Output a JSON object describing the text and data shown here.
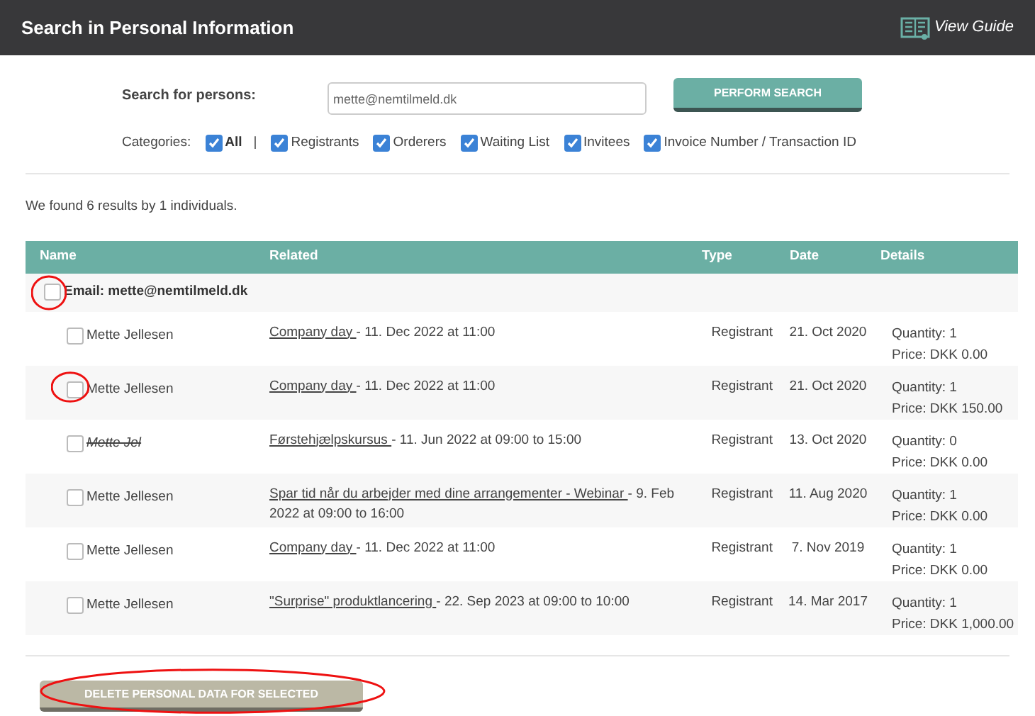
{
  "header": {
    "title": "Search in Personal Information",
    "guide_link": "View Guide"
  },
  "search": {
    "label": "Search for persons:",
    "value": "mette@nemtilmeld.dk",
    "button": "PERFORM SEARCH"
  },
  "categories": {
    "label": "Categories:",
    "separator": "|",
    "items": [
      {
        "label": "All",
        "checked": true,
        "bold": true
      },
      {
        "label": "Registrants",
        "checked": true,
        "bold": false
      },
      {
        "label": "Orderers",
        "checked": true,
        "bold": false
      },
      {
        "label": "Waiting List",
        "checked": true,
        "bold": false
      },
      {
        "label": "Invitees",
        "checked": true,
        "bold": false
      },
      {
        "label": "Invoice Number / Transaction ID",
        "checked": true,
        "bold": false
      }
    ]
  },
  "results_summary": "We found 6 results by 1 individuals.",
  "table": {
    "columns": [
      "Name",
      "Related",
      "Type",
      "Date",
      "Details"
    ],
    "group": {
      "label": "Email: mette@nemtilmeld.dk",
      "checked": false,
      "circled": true
    },
    "rows": [
      {
        "name": "Mette Jellesen",
        "cancelled": false,
        "checked": false,
        "circled": false,
        "event": "Company day ",
        "when": " - 11. Dec 2022 at 11:00",
        "type": "Registrant",
        "date": "21. Oct 2020",
        "quantity": "Quantity: 1",
        "price": "Price: DKK 0.00"
      },
      {
        "name": "Mette Jellesen",
        "cancelled": false,
        "checked": false,
        "circled": true,
        "event": "Company day ",
        "when": " - 11. Dec 2022 at 11:00",
        "type": "Registrant",
        "date": "21. Oct 2020",
        "quantity": "Quantity: 1",
        "price": "Price: DKK 150.00"
      },
      {
        "name": "Mette Jel",
        "cancelled": true,
        "checked": false,
        "circled": false,
        "event": "Førstehjælpskursus ",
        "when": " - 11. Jun 2022 at 09:00 to 15:00",
        "type": "Registrant",
        "date": "13. Oct 2020",
        "quantity": "Quantity: 0",
        "price": "Price: DKK 0.00"
      },
      {
        "name": "Mette Jellesen",
        "cancelled": false,
        "checked": false,
        "circled": false,
        "event": "Spar tid når du arbejder med dine arrangementer - Webinar ",
        "when": " - 9. Feb 2022 at 09:00 to 16:00",
        "type": "Registrant",
        "date": "11. Aug 2020",
        "quantity": "Quantity: 1",
        "price": "Price: DKK 0.00"
      },
      {
        "name": "Mette Jellesen",
        "cancelled": false,
        "checked": false,
        "circled": false,
        "event": "Company day ",
        "when": " - 11. Dec 2022 at 11:00",
        "type": "Registrant",
        "date": "7. Nov 2019",
        "quantity": "Quantity: 1",
        "price": "Price: DKK 0.00"
      },
      {
        "name": "Mette Jellesen",
        "cancelled": false,
        "checked": false,
        "circled": false,
        "event": "\"Surprise\" produktlancering ",
        "when": " - 22. Sep 2023 at 09:00 to 10:00",
        "type": "Registrant",
        "date": "14. Mar 2017",
        "quantity": "Quantity: 1",
        "price": "Price: DKK 1,000.00"
      }
    ]
  },
  "delete_button": {
    "label": "DELETE PERSONAL DATA FOR SELECTED",
    "circled": true
  }
}
